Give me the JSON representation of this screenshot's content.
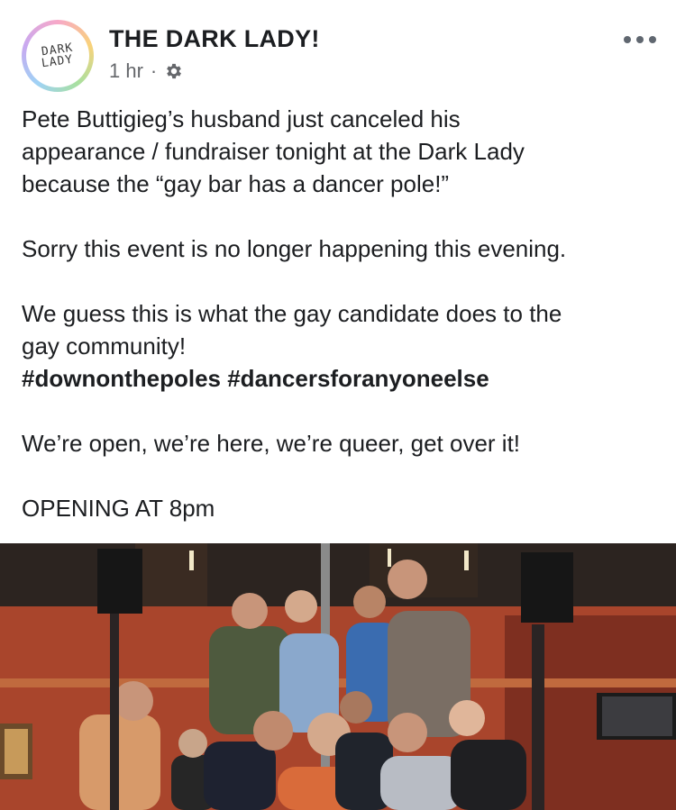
{
  "page": {
    "name": "THE DARK LADY!",
    "avatar_text_line1": "DARK",
    "avatar_text_line2": "LADY"
  },
  "meta": {
    "time": "1 hr",
    "separator": "·",
    "privacy_icon": "gear-icon"
  },
  "post": {
    "lines": [
      "Pete Buttigieg’s husband just canceled his",
      "appearance / fundraiser tonight at the Dark Lady",
      "because the “gay bar has a dancer pole!”",
      "",
      "Sorry this event is no longer happening this evening.",
      "",
      "We guess this is what the gay candidate does to the",
      "gay community!"
    ],
    "hashtags": "#downonthepoles #dancersforanyoneelse",
    "closing": [
      "We’re open, we’re here, we’re queer, get over it!",
      "OPENING AT 8pm"
    ]
  },
  "photo": {
    "subject": "group-photo"
  },
  "colors": {
    "text": "#1c1e21",
    "meta": "#65676b",
    "wall": "#a9452c",
    "ceiling": "#2c2420"
  }
}
